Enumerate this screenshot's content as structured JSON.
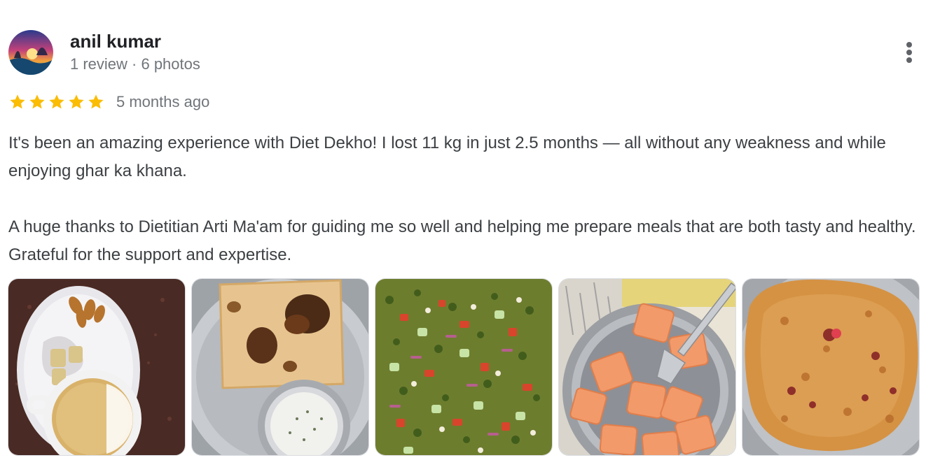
{
  "author": {
    "name": "anil kumar",
    "meta": "1 review · 6 photos",
    "avatar_icon": "sunset-landscape-avatar"
  },
  "menu": {
    "icon": "more-vertical-icon"
  },
  "rating": {
    "stars": 5,
    "max": 5,
    "star_color": "#fbbc04",
    "time": "5 months ago"
  },
  "review": {
    "paragraphs": [
      "It's been an amazing experience with Diet Dekho! I lost 11 kg in just 2.5 months — all without any weakness and while enjoying ghar ka khana.",
      "A huge thanks to Dietitian Arti Ma'am for guiding me so well and helping me prepare meals that are both tasty and healthy. Grateful for the support and expertise."
    ]
  },
  "photos": [
    {
      "subject": "almonds-and-tea-on-plate"
    },
    {
      "subject": "roti-with-raita"
    },
    {
      "subject": "sprouts-salad"
    },
    {
      "subject": "papaya-bowl-with-fork"
    },
    {
      "subject": "besan-chilla"
    }
  ]
}
